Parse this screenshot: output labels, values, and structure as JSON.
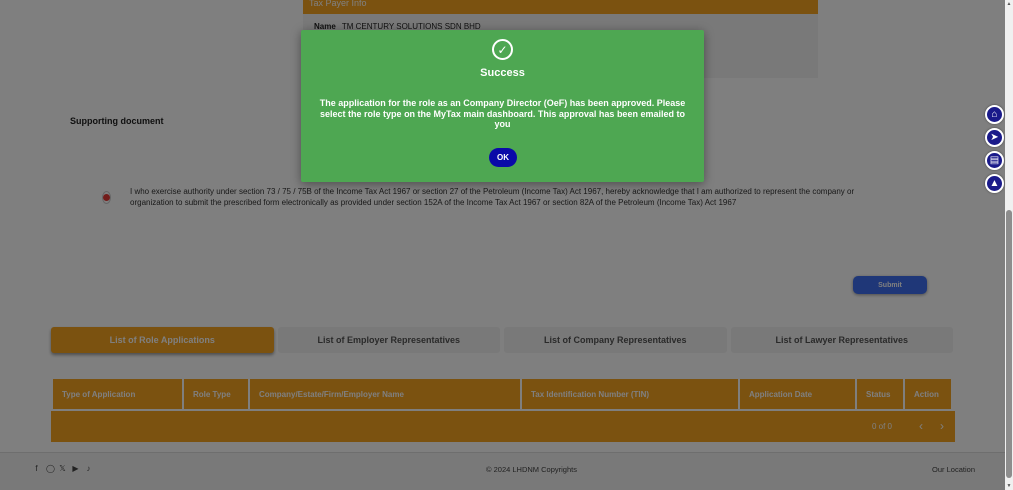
{
  "taxpayer": {
    "header": "Tax Payer Info",
    "name_label": "Name",
    "name_value": "TM CENTURY SOLUTIONS SDN BHD"
  },
  "supporting_document_label": "Supporting document",
  "declaration_text": "I who exercise authority under section 73 / 75 / 75B of the Income Tax Act 1967 or section 27 of the Petroleum (Income Tax) Act 1967, hereby acknowledge that I am authorized to represent the company or organization to submit the prescribed form electronically as provided under section 152A of the Income Tax Act 1967 or section 82A of the Petroleum (Income Tax) Act 1967",
  "submit_label": "Submit",
  "tabs": [
    {
      "label": "List of Role Applications"
    },
    {
      "label": "List of Employer Representatives"
    },
    {
      "label": "List of Company Representatives"
    },
    {
      "label": "List of Lawyer Representatives"
    }
  ],
  "table": {
    "columns": [
      "Type of Application",
      "Role Type",
      "Company/Estate/Firm/Employer Name",
      "Tax Identification Number (TIN)",
      "Application Date",
      "Status",
      "Action"
    ],
    "pager": "0 of 0"
  },
  "footer": {
    "copyright": "© 2024 LHDNM Copyrights",
    "location": "Our Location",
    "social_icons": [
      "facebook-icon",
      "instagram-icon",
      "x-icon",
      "youtube-icon",
      "tiktok-icon"
    ]
  },
  "side_icons": [
    "home-icon",
    "rocket-icon",
    "book-icon",
    "graduation-cap-icon"
  ],
  "modal": {
    "title": "Success",
    "message": "The application for the role as an Company Director (OeF) has been approved. Please select the role type on the MyTax main dashboard. This approval has been emailed to you",
    "ok_label": "OK"
  },
  "colors": {
    "accent": "#f7a521",
    "success": "#4ea752",
    "primary_button": "#3f6ff0",
    "ok_button": "#0a0aa8"
  }
}
